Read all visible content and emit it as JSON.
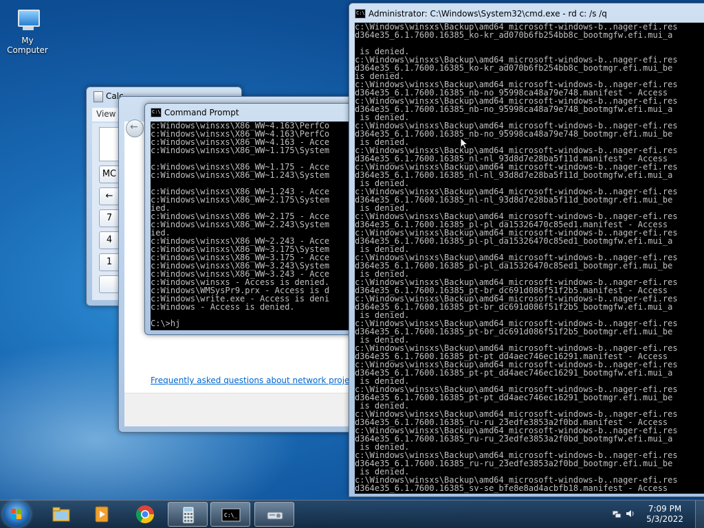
{
  "desktop": {
    "icons": [
      {
        "label": "My Computer"
      }
    ]
  },
  "calculator": {
    "title": "Calc",
    "menu_view": "View",
    "keys": [
      "MC",
      "←",
      "7",
      "4",
      "1",
      ""
    ]
  },
  "projector": {
    "faq_link": "Frequently asked questions about network projectors"
  },
  "cmd_small": {
    "title": "Command Prompt",
    "lines": [
      "c:Windows\\winsxs\\X86_WW~4.163\\PerfCo",
      "c:Windows\\winsxs\\X86_WW~4.163\\PerfCo",
      "c:Windows\\winsxs\\X86_WW~4.163 - Acce",
      "c:Windows\\winsxs\\X86_WW~1.175\\System",
      "",
      "c:Windows\\winsxs\\X86_WW~1.175 - Acce",
      "c:Windows\\winsxs\\X86_WW~1.243\\System",
      "",
      "c:Windows\\winsxs\\X86_WW~1.243 - Acce",
      "c:Windows\\winsxs\\X86_WW~2.175\\System",
      "ied.",
      "c:Windows\\winsxs\\X86_WW~2.175 - Acce",
      "c:Windows\\winsxs\\X86_WW~2.243\\System",
      "ied.",
      "c:Windows\\winsxs\\X86_WW~2.243 - Acce",
      "c:Windows\\winsxs\\X86_WW~3.175\\System",
      "c:Windows\\winsxs\\X86_WW~3.175 - Acce",
      "c:Windows\\winsxs\\X86_WW~3.243\\System",
      "c:Windows\\winsxs\\X86_WW~3.243 - Acce",
      "c:Windows\\winsxs - Access is denied.",
      "c:Windows\\WMSysPr9.prx - Access is d",
      "c:Windows\\write.exe - Access is deni",
      "c:Windows - Access is denied.",
      "",
      "C:\\>hj"
    ]
  },
  "cmd_admin": {
    "title": "Administrator: C:\\Windows\\System32\\cmd.exe - rd  c: /s /q",
    "lines": [
      "c:\\Windows\\winsxs\\Backup\\amd64_microsoft-windows-b..nager-efi.res",
      "d364e35_6.1.7600.16385_ko-kr_ad070b6fb254bb8c_bootmgfw.efi.mui_a",
      "",
      " is denied.",
      "c:\\Windows\\winsxs\\Backup\\amd64_microsoft-windows-b..nager-efi.res",
      "d364e35_6.1.7600.16385_ko-kr_ad070b6fb254bb8c_bootmgr.efi.mui_be",
      "is denied.",
      "c:\\Windows\\winsxs\\Backup\\amd64_microsoft-windows-b..nager-efi.res",
      "d364e35_6.1.7600.16385_nb-no_95998ca48a79e748.manifest - Access",
      "c:\\Windows\\winsxs\\Backup\\amd64_microsoft-windows-b..nager-efi.res",
      "d364e35_6.1.7600.16385_nb-no_95998ca48a79e748_bootmgfw.efi.mui_a",
      " is denied.",
      "c:\\Windows\\winsxs\\Backup\\amd64_microsoft-windows-b..nager-efi.res",
      "d364e35_6.1.7600.16385_nb-no_95998ca48a79e748_bootmgr.efi.mui_be",
      " is denied.",
      "c:\\Windows\\winsxs\\Backup\\amd64_microsoft-windows-b..nager-efi.res",
      "d364e35_6.1.7600.16385_nl-nl_93d8d7e28ba5f11d.manifest - Access",
      "c:\\Windows\\winsxs\\Backup\\amd64_microsoft-windows-b..nager-efi.res",
      "d364e35_6.1.7600.16385_nl-nl_93d8d7e28ba5f11d_bootmgfw.efi.mui_a",
      " is denied.",
      "c:\\Windows\\winsxs\\Backup\\amd64_microsoft-windows-b..nager-efi.res",
      "d364e35_6.1.7600.16385_nl-nl_93d8d7e28ba5f11d_bootmgr.efi.mui_be",
      " is denied.",
      "c:\\Windows\\winsxs\\Backup\\amd64_microsoft-windows-b..nager-efi.res",
      "d364e35_6.1.7600.16385_pl-pl_da15326470c85ed1.manifest - Access",
      "c:\\Windows\\winsxs\\Backup\\amd64_microsoft-windows-b..nager-efi.res",
      "d364e35_6.1.7600.16385_pl-pl_da15326470c85ed1_bootmgfw.efi.mui_a",
      " is denied.",
      "c:\\Windows\\winsxs\\Backup\\amd64_microsoft-windows-b..nager-efi.res",
      "d364e35_6.1.7600.16385_pl-pl_da15326470c85ed1_bootmgr.efi.mui_be",
      " is denied.",
      "c:\\Windows\\winsxs\\Backup\\amd64_microsoft-windows-b..nager-efi.res",
      "d364e35_6.1.7600.16385_pt-br_dc691d086f51f2b5.manifest - Access",
      "c:\\Windows\\winsxs\\Backup\\amd64_microsoft-windows-b..nager-efi.res",
      "d364e35_6.1.7600.16385_pt-br_dc691d086f51f2b5_bootmgfw.efi.mui_a",
      " is denied.",
      "c:\\Windows\\winsxs\\Backup\\amd64_microsoft-windows-b..nager-efi.res",
      "d364e35_6.1.7600.16385_pt-br_dc691d086f51f2b5_bootmgr.efi.mui_be",
      " is denied.",
      "c:\\Windows\\winsxs\\Backup\\amd64_microsoft-windows-b..nager-efi.res",
      "d364e35_6.1.7600.16385_pt-pt_dd4aec746ec16291.manifest - Access",
      "c:\\Windows\\winsxs\\Backup\\amd64_microsoft-windows-b..nager-efi.res",
      "d364e35_6.1.7600.16385_pt-pt_dd4aec746ec16291_bootmgfw.efi.mui_a",
      " is denied.",
      "c:\\Windows\\winsxs\\Backup\\amd64_microsoft-windows-b..nager-efi.res",
      "d364e35_6.1.7600.16385_pt-pt_dd4aec746ec16291_bootmgr.efi.mui_be",
      " is denied.",
      "c:\\Windows\\winsxs\\Backup\\amd64_microsoft-windows-b..nager-efi.res",
      "d364e35_6.1.7600.16385_ru-ru_23edfe3853a2f0bd.manifest - Access",
      "c:\\Windows\\winsxs\\Backup\\amd64_microsoft-windows-b..nager-efi.res",
      "d364e35_6.1.7600.16385_ru-ru_23edfe3853a2f0bd_bootmgfw.efi.mui_a",
      " is denied.",
      "c:\\Windows\\winsxs\\Backup\\amd64_microsoft-windows-b..nager-efi.res",
      "d364e35_6.1.7600.16385_ru-ru_23edfe3853a2f0bd_bootmgr.efi.mui_be",
      " is denied.",
      "c:\\Windows\\winsxs\\Backup\\amd64_microsoft-windows-b..nager-efi.res",
      "d364e35_6.1.7600.16385_sv-se_bfe8e8ad4acbfb18.manifest - Access"
    ]
  },
  "taskbar": {
    "apps": [
      {
        "icon": "windows-explorer-icon"
      },
      {
        "icon": "media-player-icon"
      },
      {
        "icon": "chrome-icon"
      },
      {
        "icon": "calculator-icon"
      },
      {
        "icon": "command-prompt-icon"
      },
      {
        "icon": "network-projector-icon"
      }
    ],
    "clock": {
      "time": "7:09 PM",
      "date": "5/3/2022"
    }
  }
}
